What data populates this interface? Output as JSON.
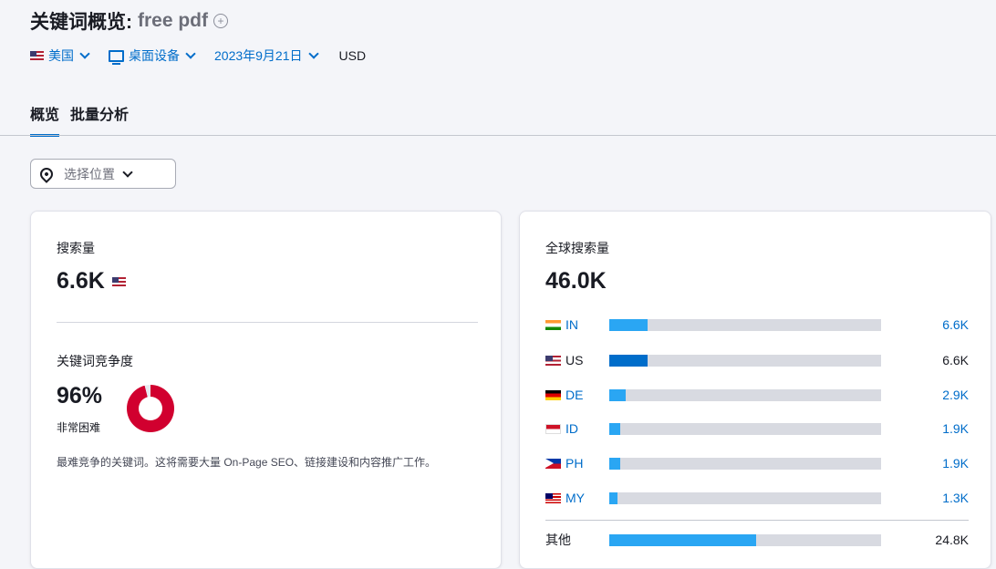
{
  "header": {
    "title": "关键词概览:",
    "keyword": "free pdf",
    "add_icon": "plus-circle-icon"
  },
  "filters": {
    "country": "美国",
    "device": "桌面设备",
    "date": "2023年9月21日",
    "currency": "USD"
  },
  "tabs": [
    {
      "label": "概览",
      "active": true
    },
    {
      "label": "批量分析",
      "active": false
    }
  ],
  "location_select": {
    "placeholder": "选择位置"
  },
  "volume_card": {
    "label": "搜索量",
    "value": "6.6K",
    "difficulty_label": "关键词竞争度",
    "difficulty_value": "96%",
    "difficulty_percent": 96,
    "difficulty_text": "非常困难",
    "description": "最难竞争的关键词。这将需要大量 On-Page SEO、链接建设和内容推广工作。"
  },
  "global_card": {
    "label": "全球搜索量",
    "value": "46.0K",
    "countries": [
      {
        "code": "IN",
        "value": "6.6K",
        "share": 0.14
      },
      {
        "code": "US",
        "value": "6.6K",
        "share": 0.14
      },
      {
        "code": "DE",
        "value": "2.9K",
        "share": 0.06
      },
      {
        "code": "ID",
        "value": "1.9K",
        "share": 0.04
      },
      {
        "code": "PH",
        "value": "1.9K",
        "share": 0.04
      },
      {
        "code": "MY",
        "value": "1.3K",
        "share": 0.03
      }
    ],
    "other": {
      "label": "其他",
      "value": "24.8K",
      "share": 0.54
    }
  },
  "colors": {
    "accent": "#006dca",
    "bar": "#2aa6f3",
    "danger": "#d1002f"
  }
}
